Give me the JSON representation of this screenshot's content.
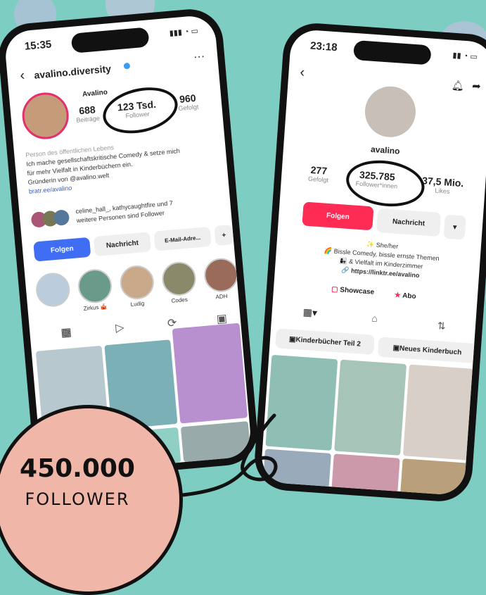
{
  "instagram": {
    "time": "15:35",
    "username": "avalino.diversity",
    "display_name": "Avalino",
    "stats": [
      {
        "value": "688",
        "label": "Beiträge"
      },
      {
        "value": "123 Tsd.",
        "label": "Follower"
      },
      {
        "value": "960",
        "label": "Gefolgt"
      }
    ],
    "bio": {
      "category": "Person des öffentlichen Lebens",
      "line1": "Ich mache gesellschaftskritische Comedy & setze mich",
      "line2": "für mehr Vielfalt in Kinderbüchern ein.",
      "line3": "Gründerin von @avalino.welt",
      "link": "bratr.ee/avalino"
    },
    "followed_by": "celine_hall_, kathycaughtfire und 7",
    "followed_by2": "weitere Personen sind Follower",
    "buttons": {
      "follow": "Folgen",
      "message": "Nachricht",
      "email": "E-Mail-Adre..."
    },
    "stories": [
      "",
      "Zirkus 🎪",
      "Ludig",
      "Codes",
      "ADH"
    ]
  },
  "tiktok": {
    "time": "23:18",
    "username": "avalino",
    "stats": [
      {
        "value": "277",
        "label": "Gefolgt"
      },
      {
        "value": "325.785",
        "label": "Follower*innen"
      },
      {
        "value": "37,5 Mio.",
        "label": "Likes"
      }
    ],
    "buttons": {
      "follow": "Folgen",
      "message": "Nachricht"
    },
    "bio": {
      "line1": "✨ She/her",
      "line2": "🌈 Bissle Comedy, bissle ernste Themen",
      "line3": "👩‍👧 & Vielfalt im Kinderzimmer",
      "link": "🔗 https://linktr.ee/avalino"
    },
    "showcase": "Showcase",
    "abo": "Abo",
    "playlists": [
      "Kinderbücher Teil 2",
      "Neues Kinderbuch"
    ]
  },
  "badge": {
    "number": "450.000",
    "label": "FOLLOWER"
  },
  "colors": {
    "bg": "#7ecdc3",
    "badge": "#f0b7a8",
    "ig_blue": "#3f6ef4",
    "tt_red": "#fe2c55"
  }
}
